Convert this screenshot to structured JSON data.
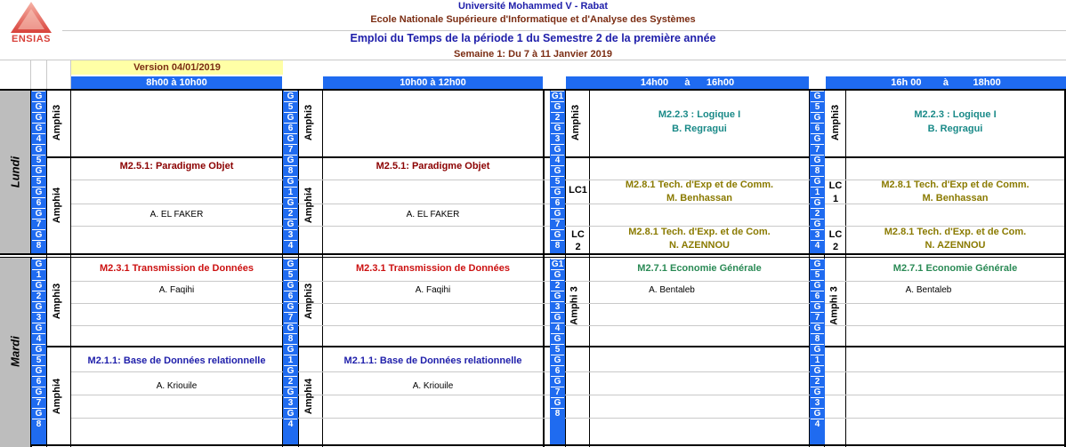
{
  "header": {
    "university": "Université Mohammed V - Rabat",
    "school": "Ecole Nationale Supérieure d'Informatique et d'Analyse des Systèmes",
    "title": "Emploi du Temps de la période 1 du Semestre 2 de la première année",
    "week": "Semaine 1: Du 7 à 11 Janvier 2019",
    "logo_text": "ENSIAS",
    "version": "Version 04/01/2019"
  },
  "colors": {
    "blue": "#1f6bf0",
    "maroon": "#7b2d13",
    "navy": "#1e1eaa",
    "teal": "#1a8a88",
    "olive": "#8a7a00",
    "red": "#cc1111",
    "green": "#2a8a55",
    "darkred": "#8b0000"
  },
  "times": [
    "8h00 à 10h00",
    "10h00 à 12h00",
    "14h00      à      16h00",
    "16h 00        à         18h00"
  ],
  "days": {
    "monday": "Lundi",
    "tuesday": "Mardi"
  },
  "rooms": {
    "amphi3": "Amphi3",
    "amphi4": "Amphi4",
    "amphi_3": "Amphi 3"
  },
  "groups": {
    "g": "G",
    "g1": "G1",
    "n1": "1",
    "n2": "2",
    "n3": "3",
    "n4": "4",
    "n5": "5",
    "n6": "6",
    "n7": "7",
    "n8": "8"
  },
  "labels": {
    "lc1": "LC1",
    "lc": "LC",
    "lc_n1": "1",
    "lc_n2": "2"
  },
  "courses": {
    "m225": "M2.5.1: Paradigme Objet",
    "m225_teacher": "A. EL FAKER",
    "m223": "M2.2.3 : Logique I",
    "m223_teacher": "B. Regragui",
    "m281a": "M2.8.1 Tech. d'Exp et de Comm.",
    "m281a_teacher": "M. Benhassan",
    "m281b": "M2.8.1 Tech. d'Exp. et de Com.",
    "m281b_teacher": "N. AZENNOU",
    "m231": "M2.3.1 Transmission de Données",
    "m231_teacher": "A. Faqihi",
    "m271": "M2.7.1 Economie Générale",
    "m271_teacher": "A. Bentaleb",
    "m211": "M2.1.1: Base de Données relationnelle",
    "m211_teacher": "A. Kriouile"
  }
}
